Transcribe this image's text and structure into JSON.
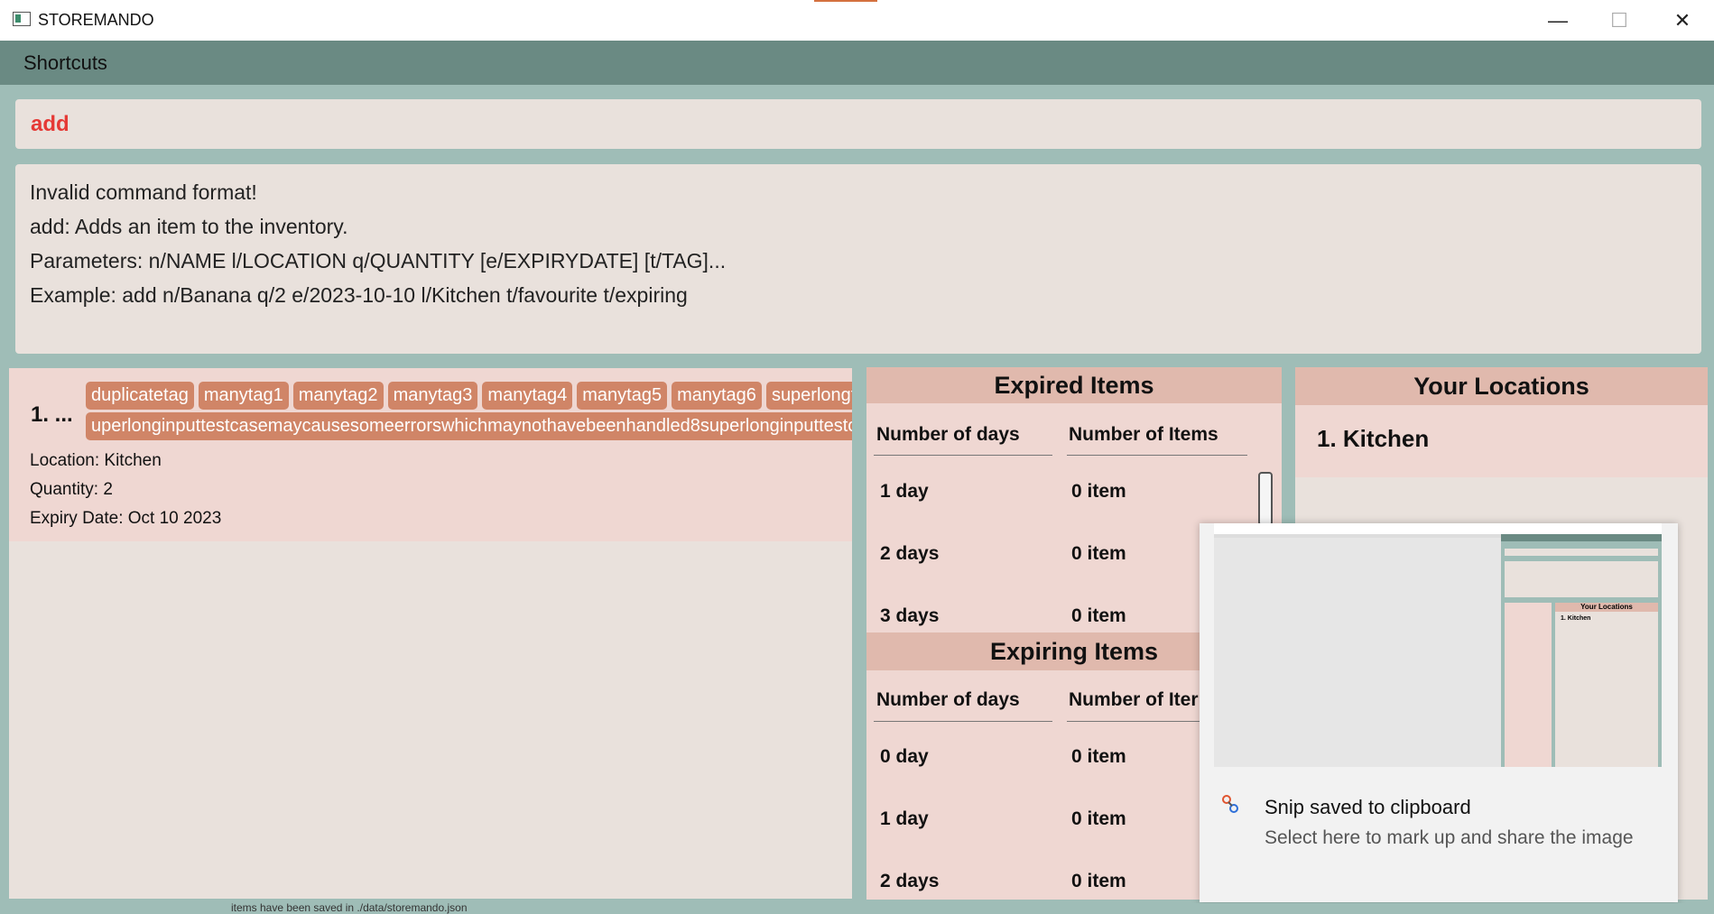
{
  "window": {
    "title": "STOREMANDO",
    "minimize_icon": "minimize-icon",
    "maximize_icon": "maximize-icon",
    "close_icon": "close-icon"
  },
  "menu": {
    "shortcuts": "Shortcuts"
  },
  "command": {
    "value": "add"
  },
  "result": {
    "lines": [
      "Invalid command format!",
      "add: Adds an item to the inventory.",
      "Parameters: n/NAME l/LOCATION q/QUANTITY [e/EXPIRYDATE] [t/TAG]...",
      "Example: add n/Banana q/2 e/2023-10-10 l/Kitchen t/favourite t/expiring"
    ]
  },
  "items": [
    {
      "index": "1. ...",
      "tags_row1": [
        "duplicatetag",
        "manytag1",
        "manytag2",
        "manytag3",
        "manytag4",
        "manytag5",
        "manytag6",
        "superlongta"
      ],
      "tags_row2": [
        "uperlonginputtestcasemaycausesomeerrorswhichmaynothavebeenhandled8superlonginputtestcase"
      ],
      "location": "Location: Kitchen",
      "quantity": "Quantity: 2",
      "expiry": "Expiry Date: Oct 10 2023"
    }
  ],
  "expired": {
    "title": "Expired Items",
    "col_days": "Number of days",
    "col_items": "Number of Items",
    "rows": [
      {
        "days": "1 day",
        "items": "0 item"
      },
      {
        "days": "2 days",
        "items": "0 item"
      },
      {
        "days": "3 days",
        "items": "0 item"
      }
    ]
  },
  "expiring": {
    "title": "Expiring Items",
    "col_days": "Number of days",
    "col_items": "Number of Iter",
    "rows": [
      {
        "days": "0 day",
        "items": "0 item"
      },
      {
        "days": "1 day",
        "items": "0 item"
      },
      {
        "days": "2 days",
        "items": "0 item"
      }
    ]
  },
  "locations": {
    "title": "Your Locations",
    "items": [
      "1. Kitchen"
    ]
  },
  "thumbnail": {
    "locations_title": "Your Locations",
    "location_item": "1. Kitchen"
  },
  "toast": {
    "icon": "snipping-tool-icon",
    "title": "Snip saved to clipboard",
    "body": "Select here to mark up and share the image"
  },
  "status": {
    "text": "items have been saved in ./data/storemando.json"
  },
  "colors": {
    "background": "#9fbdb7",
    "menubar": "#6a8a83",
    "panel": "#e9e1dc",
    "card": "#efd7d2",
    "header": "#e0b9ad",
    "tag": "#d08567",
    "command_error": "#e53935"
  }
}
